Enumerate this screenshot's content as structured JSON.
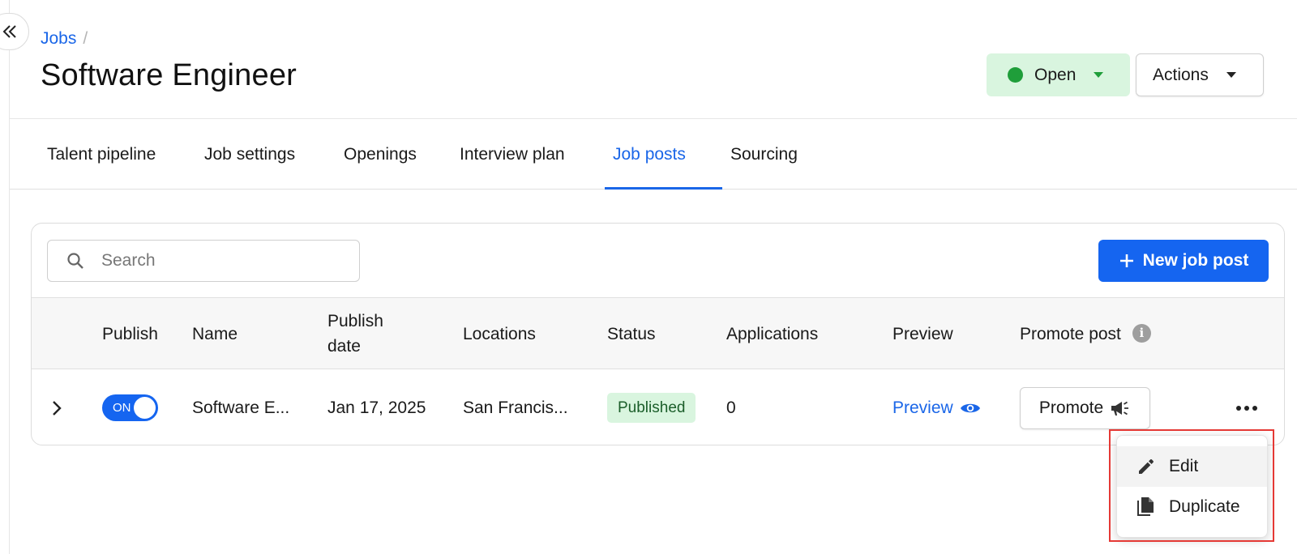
{
  "breadcrumb": {
    "root": "Jobs",
    "separator": "/"
  },
  "page": {
    "title": "Software Engineer"
  },
  "status_button": {
    "label": "Open",
    "dot_color": "#1f9e3a"
  },
  "actions_button": {
    "label": "Actions"
  },
  "tabs": [
    {
      "label": "Talent pipeline"
    },
    {
      "label": "Job settings"
    },
    {
      "label": "Openings"
    },
    {
      "label": "Interview plan"
    },
    {
      "label": "Job posts",
      "active": true
    },
    {
      "label": "Sourcing"
    }
  ],
  "search": {
    "placeholder": "Search",
    "value": ""
  },
  "new_post_button": {
    "label": "New job post",
    "icon": "plus-icon"
  },
  "table": {
    "headers": {
      "publish": "Publish",
      "name": "Name",
      "publish_date_line1": "Publish",
      "publish_date_line2": "date",
      "locations": "Locations",
      "status": "Status",
      "applications": "Applications",
      "preview": "Preview",
      "promote_post": "Promote post"
    },
    "rows": [
      {
        "toggle": "ON",
        "name": "Software E...",
        "publish_date": "Jan 17, 2025",
        "location": "San Francis...",
        "status": "Published",
        "applications": "0",
        "preview": "Preview",
        "promote": "Promote"
      }
    ]
  },
  "context_menu": {
    "items": [
      {
        "label": "Edit",
        "icon": "pencil-icon"
      },
      {
        "label": "Duplicate",
        "icon": "copy-icon"
      }
    ]
  },
  "colors": {
    "accent": "#1565f0",
    "link": "#1a66e8",
    "success_bg": "#d9f5df",
    "highlight": "#e53935"
  }
}
